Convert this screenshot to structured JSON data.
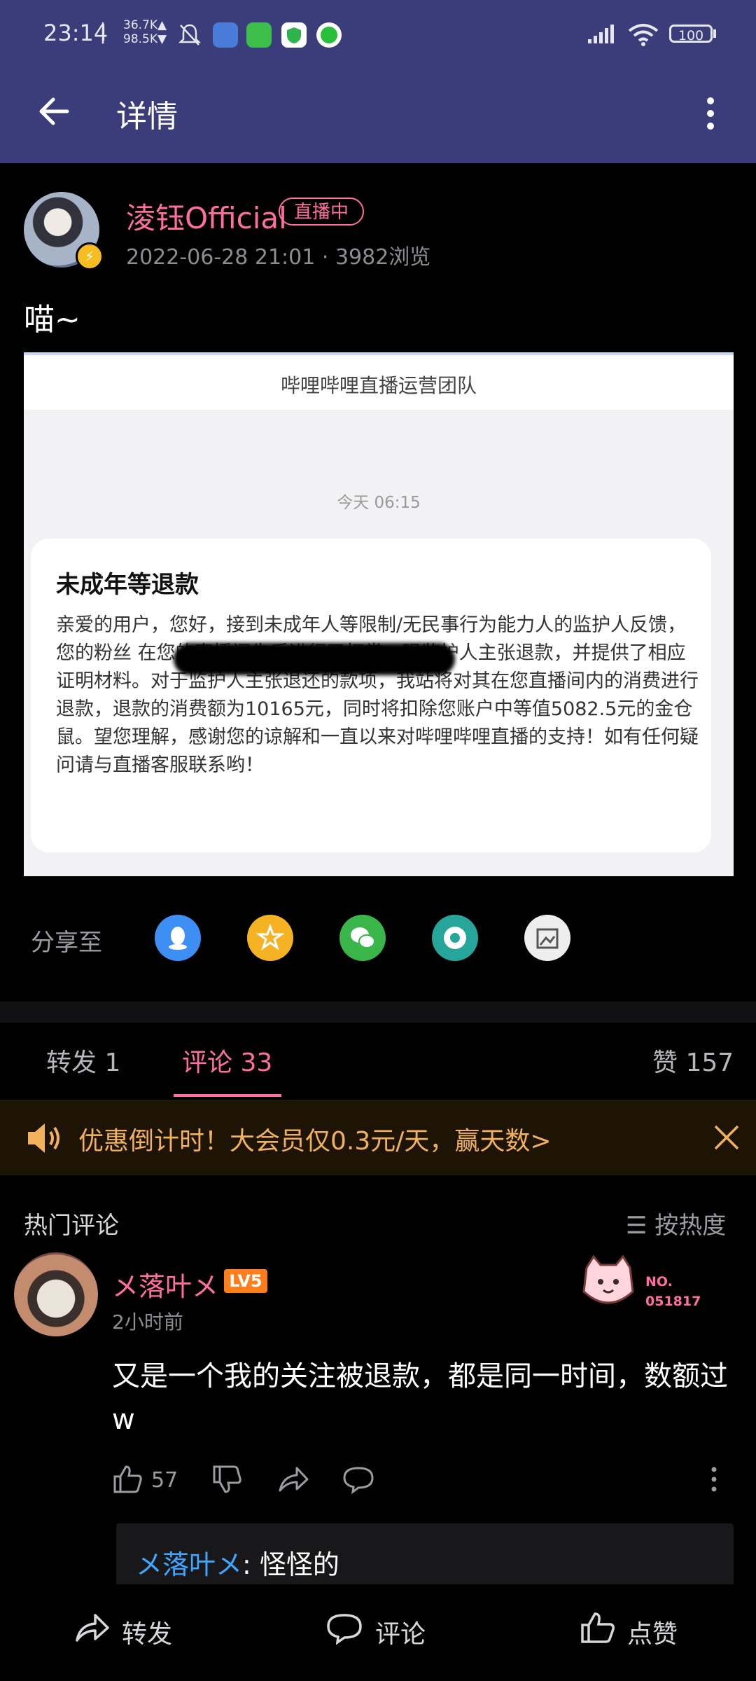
{
  "status_bar": {
    "time": "23:14",
    "speed_up": "36.7K▲",
    "speed_down": "98.5K▼",
    "battery": "100"
  },
  "nav": {
    "title": "详情"
  },
  "post": {
    "author": "淩钰Official",
    "live_badge": "直播中",
    "meta": "2022-06-28 21:01 · 3982浏览",
    "text": "喵~",
    "image": {
      "header": "哔哩哔哩直播运营团队",
      "timestamp": "今天 06:15",
      "title": "未成年等退款",
      "body": "亲爱的用户，您好，接到未成年人等限制/无民事行为能力人的监护人反馈，您的粉丝                                   在您的直播间先后进行了打赏。现监护人主张退款，并提供了相应证明材料。对于监护人主张退还的款项，我站将对其在您直播间内的消费进行退款，退款的消费额为10165元，同时将扣除您账户中等值5082.5元的金仓鼠。望您理解，感谢您的谅解和一直以来对哔哩哔哩直播的支持！如有任何疑问请与直播客服联系哟！"
    }
  },
  "share": {
    "label": "分享至",
    "targets": [
      "qq-icon",
      "qzone-icon",
      "wechat-icon",
      "moments-icon",
      "gallery-icon"
    ],
    "colors": [
      "#3d8ff3",
      "#f5b324",
      "#39b54a",
      "#26a69a",
      "#eeeeee"
    ]
  },
  "tabs": {
    "forward": "转发 1",
    "comment": "评论 33",
    "like": "赞 157"
  },
  "promo": {
    "text": "优惠倒计时！大会员仅0.3元/天，赢天数>"
  },
  "comments": {
    "section_title": "热门评论",
    "sort_label": "☰ 按热度",
    "items": [
      {
        "user": "メ落叶メ",
        "level": "LV5",
        "time": "2小时前",
        "fan_no_label": "NO.",
        "fan_no": "051817",
        "text": "又是一个我的关注被退款，都是同一时间，数额过w",
        "likes": "57",
        "reply_user": "メ落叶メ",
        "reply_text": ": 怪怪的"
      }
    ]
  },
  "bottom_bar": {
    "forward": "转发",
    "comment": "评论",
    "like": "点赞"
  },
  "colors": {
    "header_bg": "#3b3d7a",
    "accent_pink": "#ff6f9e",
    "promo_text": "#f1b15d",
    "reply_link": "#3ea6ff"
  }
}
